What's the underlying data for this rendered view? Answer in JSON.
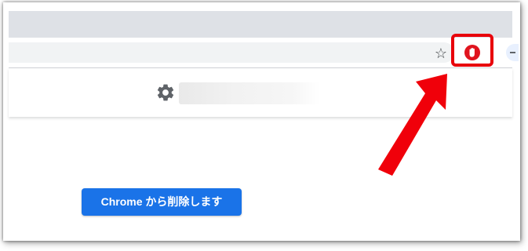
{
  "browser": {
    "star_icon": "☆",
    "extension_icon": "adblock-hand-icon",
    "highlight_color": "#e8000b"
  },
  "page": {
    "settings_icon": "gear-icon",
    "remove_button_label": "Chrome から削除します",
    "button_color": "#1a73e8"
  },
  "annotation": {
    "arrow_color": "#f0000a"
  }
}
